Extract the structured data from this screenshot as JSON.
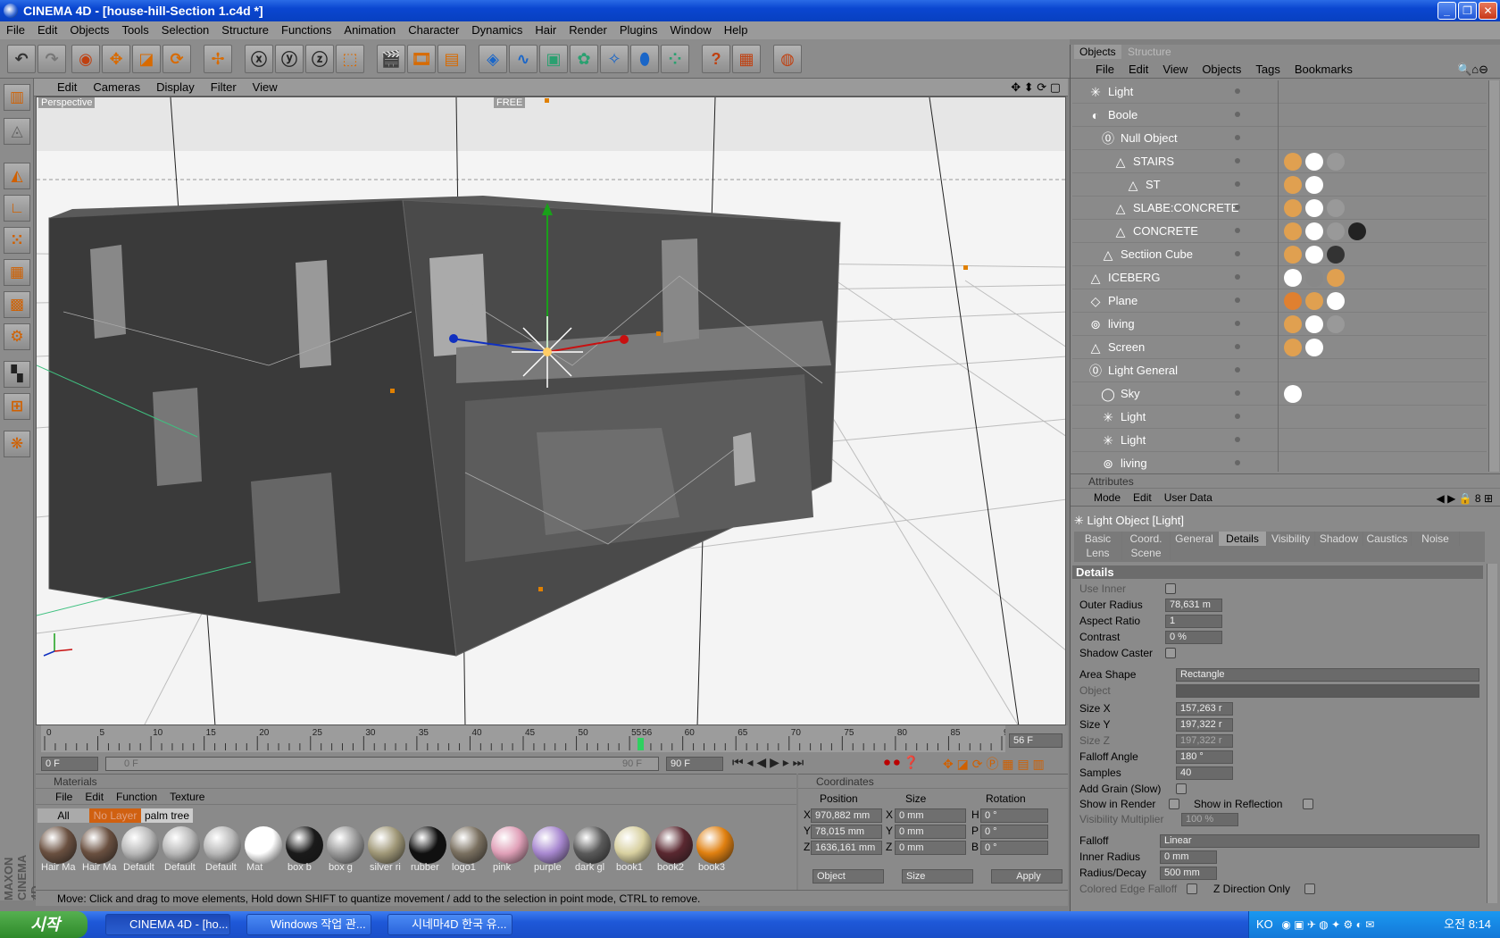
{
  "window": {
    "title": "CINEMA 4D - [house-hill-Section 1.c4d *]"
  },
  "menu": [
    "File",
    "Edit",
    "Objects",
    "Tools",
    "Selection",
    "Structure",
    "Functions",
    "Animation",
    "Character",
    "Dynamics",
    "Hair",
    "Render",
    "Plugins",
    "Window",
    "Help"
  ],
  "viewport": {
    "menu": [
      "Edit",
      "Cameras",
      "Display",
      "Filter",
      "View"
    ],
    "label": "Perspective",
    "free_label": "FREE"
  },
  "timeline": {
    "ticks": [
      "0",
      "5",
      "10",
      "15",
      "20",
      "25",
      "30",
      "35",
      "40",
      "45",
      "50",
      "55",
      "56",
      "60",
      "65",
      "70",
      "75",
      "80",
      "85",
      "90"
    ],
    "current_frame": "56 F",
    "start_frame": "0 F",
    "range_start": "0 F",
    "range_end": "90 F",
    "end_frame": "90 F",
    "current_frame_value": 56,
    "frame_max": 90
  },
  "materials": {
    "title": "Materials",
    "menu": [
      "File",
      "Edit",
      "Function",
      "Texture"
    ],
    "filters": [
      "All",
      "No Layer",
      "palm tree"
    ],
    "items": [
      {
        "label": "Hair Ma",
        "color": "#6a5040"
      },
      {
        "label": "Hair Ma",
        "color": "#6a5040"
      },
      {
        "label": "Default",
        "color": "#b8b8b8"
      },
      {
        "label": "Default",
        "color": "#b8b8b8"
      },
      {
        "label": "Default",
        "color": "#b8b8b8"
      },
      {
        "label": "Mat",
        "color": "#ffffff"
      },
      {
        "label": "box b",
        "color": "#1a1a1a"
      },
      {
        "label": "box g",
        "color": "#9a9a9a"
      },
      {
        "label": "silver ri",
        "color": "#a09878"
      },
      {
        "label": "rubber",
        "color": "#101010"
      },
      {
        "label": "logo1",
        "color": "#7a7060"
      },
      {
        "label": "pink",
        "color": "#e0a0b8"
      },
      {
        "label": "purple",
        "color": "#a888d0"
      },
      {
        "label": "dark gl",
        "color": "#5a5a5a"
      },
      {
        "label": "book1",
        "color": "#d8d0a0"
      },
      {
        "label": "book2",
        "color": "#5a2830"
      },
      {
        "label": "book3",
        "color": "#e08010"
      }
    ]
  },
  "coordinates": {
    "title": "Coordinates",
    "headers": [
      "Position",
      "Size",
      "Rotation"
    ],
    "rows": [
      {
        "axis": "X",
        "pos": "970,882 mm",
        "size_axis": "X",
        "size": "0 mm",
        "rot_axis": "H",
        "rot": "0 °"
      },
      {
        "axis": "Y",
        "pos": "78,015 mm",
        "size_axis": "Y",
        "size": "0 mm",
        "rot_axis": "P",
        "rot": "0 °"
      },
      {
        "axis": "Z",
        "pos": "1636,161 mm",
        "size_axis": "Z",
        "size": "0 mm",
        "rot_axis": "B",
        "rot": "0 °"
      }
    ],
    "mode": "Object",
    "size_mode": "Size",
    "apply": "Apply"
  },
  "status": "Move: Click and drag to move elements, Hold down SHIFT to quantize movement / add to the selection in point mode, CTRL to remove.",
  "objects": {
    "tabs": [
      "Objects",
      "Structure"
    ],
    "menu": [
      "File",
      "Edit",
      "View",
      "Objects",
      "Tags",
      "Bookmarks"
    ],
    "rows": [
      {
        "name": "Light",
        "indent": 0,
        "icon": "light-icon"
      },
      {
        "name": "Boole",
        "indent": 0,
        "icon": "boole-icon"
      },
      {
        "name": "Null Object",
        "indent": 1,
        "icon": "null-icon"
      },
      {
        "name": "STAIRS",
        "indent": 2,
        "icon": "polygon-icon"
      },
      {
        "name": "ST",
        "indent": 3,
        "icon": "polygon-icon"
      },
      {
        "name": "SLABE:CONCRETE",
        "indent": 2,
        "icon": "polygon-icon"
      },
      {
        "name": "CONCRETE",
        "indent": 2,
        "icon": "polygon-icon"
      },
      {
        "name": "Sectiion Cube",
        "indent": 1,
        "icon": "polygon-icon"
      },
      {
        "name": "ICEBERG",
        "indent": 0,
        "icon": "polygon-icon"
      },
      {
        "name": "Plane",
        "indent": 0,
        "icon": "plane-icon"
      },
      {
        "name": "living",
        "indent": 0,
        "icon": "camera-icon"
      },
      {
        "name": "Screen",
        "indent": 0,
        "icon": "polygon-icon"
      },
      {
        "name": "Light  General",
        "indent": 0,
        "icon": "null-icon"
      },
      {
        "name": "Sky",
        "indent": 1,
        "icon": "sky-icon"
      },
      {
        "name": "Light",
        "indent": 1,
        "icon": "light-icon"
      },
      {
        "name": "Light",
        "indent": 1,
        "icon": "light-icon"
      },
      {
        "name": "living",
        "indent": 1,
        "icon": "camera-icon"
      }
    ]
  },
  "attributes": {
    "title": "Attributes",
    "menu": [
      "Mode",
      "Edit",
      "User Data"
    ],
    "object": "Light Object [Light]",
    "tabs_row1": [
      "Basic",
      "Coord.",
      "General",
      "Details",
      "Visibility",
      "Shadow",
      "Caustics",
      "Noise"
    ],
    "tabs_row2": [
      "Lens",
      "Scene"
    ],
    "active_tab": "Details",
    "section": "Details",
    "use_inner": "Use Inner",
    "outer_radius": {
      "label": "Outer Radius",
      "value": "78,631 m"
    },
    "aspect_ratio": {
      "label": "Aspect Ratio",
      "value": "1"
    },
    "contrast": {
      "label": "Contrast",
      "value": "0 %"
    },
    "shadow_caster": "Shadow Caster",
    "area_shape": {
      "label": "Area Shape",
      "value": "Rectangle"
    },
    "object_field": "Object",
    "size_x": {
      "label": "Size X",
      "value": "157,263 r"
    },
    "size_y": {
      "label": "Size Y",
      "value": "197,322 r"
    },
    "size_z": {
      "label": "Size Z",
      "value": "197,322 r"
    },
    "falloff_angle": {
      "label": "Falloff Angle",
      "value": "180 °"
    },
    "samples": {
      "label": "Samples",
      "value": "40"
    },
    "add_grain": "Add Grain (Slow)",
    "show_in_render": "Show in Render",
    "show_in_reflection": "Show in Reflection",
    "visibility_multiplier": {
      "label": "Visibility Multiplier",
      "value": "100 %"
    },
    "falloff": {
      "label": "Falloff",
      "value": "Linear"
    },
    "inner_radius": {
      "label": "Inner Radius",
      "value": "0 mm"
    },
    "radius_decay": {
      "label": "Radius/Decay",
      "value": "500 mm"
    },
    "colored_edge": "Colored Edge Falloff",
    "z_direction": "Z Direction Only"
  },
  "taskbar": {
    "start": "시작",
    "tasks": [
      "CINEMA 4D - [ho...",
      "Windows 작업 관...",
      "시네마4D 한국 유..."
    ],
    "lang": "KO",
    "clock": "오전 8:14"
  },
  "brand": "MAXON CINEMA 4D"
}
